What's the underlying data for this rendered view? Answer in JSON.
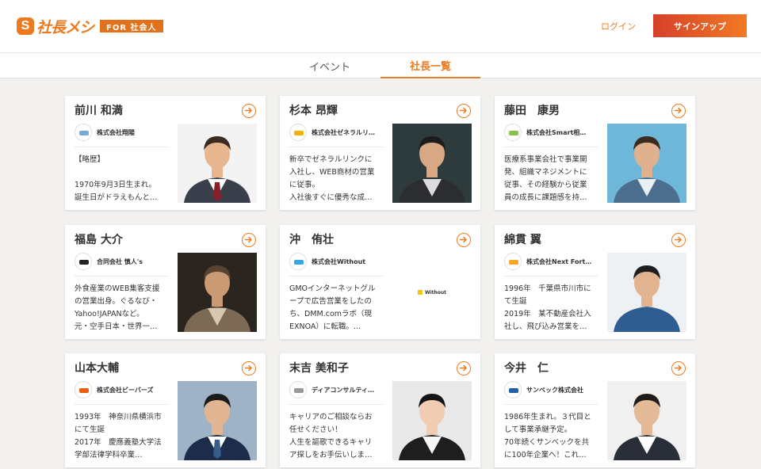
{
  "header": {
    "logo_text": "社長メシ",
    "logo_badge": "FOR 社会人",
    "login_label": "ログイン",
    "signup_label": "サインアップ"
  },
  "tabs": [
    {
      "label": "イベント"
    },
    {
      "label": "社長一覧"
    }
  ],
  "cards": [
    {
      "name": "前川 和満",
      "company": "株式会社翔陽",
      "bio": [
        "【略歴】",
        "",
        "1970年9月3日生まれ。",
        "誕生日がドラえもんと…"
      ]
    },
    {
      "name": "杉本 昂輝",
      "company": "株式会社ゼネラルリ…",
      "bio": [
        "新卒でゼネラルリンクに",
        "入社し、WEB商材の営業",
        "に従事。",
        "入社後すぐに優秀な成…"
      ]
    },
    {
      "name": "藤田　康男",
      "company": "株式会社Smart相…",
      "bio": [
        "医療系事業会社で事業開",
        "発、組織マネジメントに",
        "従事、その経験から従業",
        "員の成長に課題感を持…"
      ]
    },
    {
      "name": "福島 大介",
      "company": "合同会社 慎人's",
      "bio": [
        "外食産業のWEB集客支援",
        "の営業出身。ぐるなび・",
        "Yahoo!JAPANなど。",
        "元・空手日本・世界一…"
      ]
    },
    {
      "name": "沖　侑壮",
      "company": "株式会社Without",
      "photo_text": "Without",
      "bio": [
        "GMOインターネットグル",
        "ープで広告営業をしたの",
        "ち、DMM.comラボ（現",
        "EXNOA）に転職。…"
      ]
    },
    {
      "name": "綿貫 翼",
      "company": "株式会社Next Fort…",
      "bio": [
        "1996年　千葉県市川市に",
        "て生誕",
        "2019年　某不動産会社入",
        "社し、飛び込み営業を…"
      ]
    },
    {
      "name": "山本大輔",
      "company": "株式会社ビーバーズ",
      "bio": [
        "1993年　神奈川県横浜市",
        "にて生誕",
        "2017年　慶應義塾大学法",
        "学部法律学科卒業…"
      ]
    },
    {
      "name": "末吉 美和子",
      "company": "ディアコンサルティ…",
      "bio": [
        "キャリアのご相談ならお",
        "任せください！",
        "人生を謳歌できるキャリ",
        "ア探しをお手伝いしま…"
      ]
    },
    {
      "name": "今井　仁",
      "company": "サンベック株式会社",
      "bio": [
        "1986年生まれ。３代目と",
        "して事業承継予定。",
        "70年続くサンベックを共",
        "に100年企業へ！これ…"
      ]
    }
  ],
  "colors": {
    "accent": "#ee7a1f",
    "signup_gradient_start": "#d6402a",
    "signup_gradient_end": "#f07a24",
    "page_bg": "#f2f1ef"
  },
  "icons": [
    "arrow-circle-icon",
    "company-logo"
  ]
}
